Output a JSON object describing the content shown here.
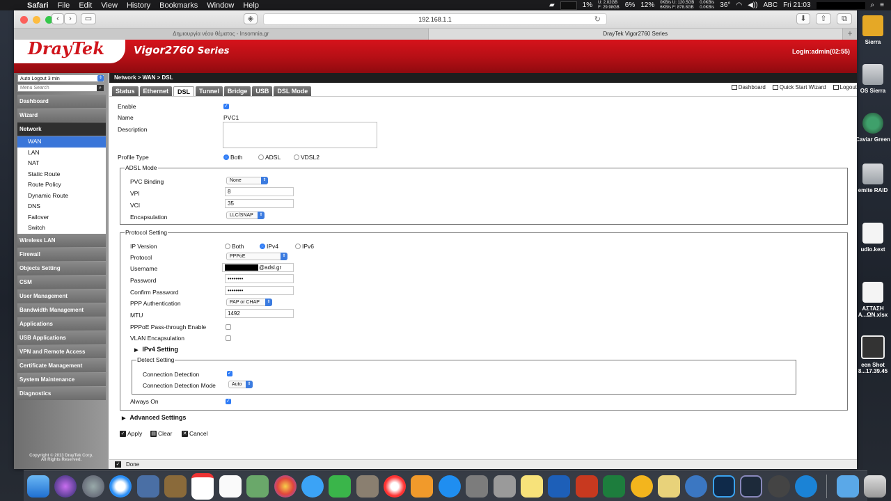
{
  "menubar": {
    "app": "Safari",
    "items": [
      "File",
      "Edit",
      "View",
      "History",
      "Bookmarks",
      "Window",
      "Help"
    ],
    "status": {
      "cpu": "1%",
      "mem1": "6%",
      "mem1_detail_u": "U: 2.02GB",
      "mem1_detail_f": "F: 29.98GB",
      "mem2": "12%",
      "net1": "0KB/s U: 120.5GB",
      "net2": "6KB/s F: 878.8GB",
      "net3": "0.0KB/s",
      "net4": "0.0KB/s",
      "temp": "36°",
      "input": "ABC",
      "clock": "Fri 21:03"
    }
  },
  "safari": {
    "url": "192.168.1.1",
    "tabs": [
      "Δημιουργία νέου θέματος - Insomnia.gr",
      "DrayTek Vigor2760 Series"
    ],
    "active_tab": 1
  },
  "header": {
    "logo": "DrayTek",
    "model": "Vigor2760",
    "series": "Series",
    "login": "Login:admin(02:55)"
  },
  "sidebar": {
    "logout_select": "Auto Logout 3 min",
    "search_placeholder": "Menu Search",
    "sections_top": [
      "Dashboard",
      "Wizard",
      "Network"
    ],
    "network_items": [
      "WAN",
      "LAN",
      "NAT",
      "Static Route",
      "Route Policy",
      "Dynamic Route",
      "DNS",
      "Failover",
      "Switch"
    ],
    "active_item": "WAN",
    "sections_bottom": [
      "Wireless LAN",
      "Firewall",
      "Objects Setting",
      "CSM",
      "User Management",
      "Bandwidth Management",
      "Applications",
      "USB Applications",
      "VPN and Remote Access",
      "Certificate Management",
      "System Maintenance",
      "Diagnostics"
    ],
    "copyright1": "Copyright © 2013 DrayTek Corp.",
    "copyright2": "All Rights Reserved."
  },
  "content": {
    "breadcrumb": "Network > WAN > DSL",
    "links": [
      "Dashboard",
      "Quick Start Wizard",
      "Logout"
    ],
    "tabs": [
      "Status",
      "Ethernet",
      "DSL",
      "Tunnel",
      "Bridge",
      "USB",
      "DSL Mode"
    ],
    "active_tab": "DSL",
    "form": {
      "enable_label": "Enable",
      "enable": true,
      "name_label": "Name",
      "name_value": "PVC1",
      "description_label": "Description",
      "description_value": "",
      "profile_type_label": "Profile Type",
      "profile_options": [
        "Both",
        "ADSL",
        "VDSL2"
      ],
      "profile_selected": "Both",
      "adsl_legend": "ADSL Mode",
      "pvc_binding_label": "PVC Binding",
      "pvc_binding_value": "None",
      "vpi_label": "VPI",
      "vpi_value": "8",
      "vci_label": "VCI",
      "vci_value": "35",
      "encap_label": "Encapsulation",
      "encap_value": "LLC/SNAP",
      "protocol_legend": "Protocol Setting",
      "ip_version_label": "IP Version",
      "ip_options": [
        "Both",
        "IPv4",
        "IPv6"
      ],
      "ip_selected": "IPv4",
      "protocol_label": "Protocol",
      "protocol_value": "PPPoE",
      "username_label": "Username",
      "username_suffix": "@adsl.gr",
      "password_label": "Password",
      "password_value": "••••••••",
      "confirm_label": "Confirm Password",
      "confirm_value": "••••••••",
      "ppp_auth_label": "PPP Authentication",
      "ppp_auth_value": "PAP or CHAP",
      "mtu_label": "MTU",
      "mtu_value": "1492",
      "passthrough_label": "PPPoE Pass-through Enable",
      "passthrough": false,
      "vlan_label": "VLAN Encapsulation",
      "vlan": false,
      "ipv4_setting": "IPv4 Setting",
      "detect_legend": "Detect Setting",
      "conn_detect_label": "Connection Detection",
      "conn_detect": true,
      "conn_mode_label": "Connection Detection Mode",
      "conn_mode_value": "Auto",
      "always_on_label": "Always On",
      "always_on": true,
      "advanced": "Advanced Settings"
    },
    "buttons": [
      "Apply",
      "Clear",
      "Cancel"
    ],
    "status_text": "Done"
  },
  "desktop_icons": [
    "Sierra",
    "OS Sierra",
    "Caviar Green",
    "emite RAID",
    "udio.kext",
    "ΑΣΤΑΣΗ\nA...ΩN.xlsx",
    "een Shot\n8...17.39.45"
  ],
  "colors": {
    "brand_red": "#d0151c",
    "accent_blue": "#3a76d9",
    "sidebar_grey": "#7a7a7a"
  }
}
